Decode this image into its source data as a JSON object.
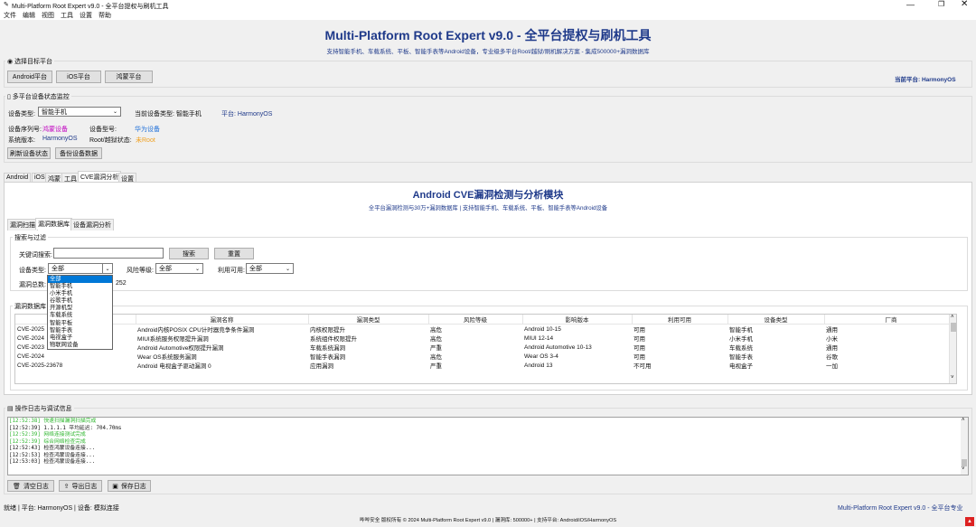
{
  "window": {
    "title": "Multi-Platform Root Expert v9.0 - 全平台提权与刷机工具",
    "menu": [
      "文件",
      "编辑",
      "视图",
      "工具",
      "设置",
      "帮助"
    ]
  },
  "header": {
    "title": "Multi-Platform Root Expert v9.0 - 全平台提权与刷机工具",
    "subtitle": "支持智能手机、车载系统、平板、智能手表等Android设备，专业级多平台Root/越狱/刷机解决方案 - 集成500000+漏洞数据库"
  },
  "platform_select": {
    "label": "选择目标平台",
    "buttons": [
      "Android平台",
      "iOS平台",
      "鸿蒙平台"
    ],
    "current": "当前平台: HarmonyOS"
  },
  "monitor": {
    "label": "多平台设备状态监控",
    "device_type_label": "设备类型:",
    "device_type_value": "智能手机",
    "current_type": "当前设备类型: 智能手机",
    "platform": "平台:  HarmonyOS",
    "serial_label": "设备序列号:",
    "serial_value": "鸿蒙设备",
    "model_label": "设备型号:",
    "model_value": "华为设备",
    "sysver_label": "系统版本:",
    "sysver_value": "HarmonyOS",
    "root_label": "Root/越狱状态:",
    "root_value": "未Root",
    "refresh_btn": "刷新设备状态",
    "backup_btn": "备份设备数据"
  },
  "main_tabs": [
    "Android",
    "iOS",
    "鸿蒙",
    "工具",
    "CVE漏洞分析",
    "设置"
  ],
  "cve": {
    "title": "Android CVE漏洞检测与分析模块",
    "subtitle": "全平台漏洞检测与30万+漏洞数据库 | 支持智能手机、车载系统、平板、智能手表等Android设备",
    "sub_tabs": [
      "漏洞扫描",
      "漏洞数据库",
      "设备漏洞分析"
    ],
    "search": {
      "group_label": "搜索与过滤",
      "keyword_label": "关键词搜索:",
      "keyword_value": "",
      "search_btn": "搜索",
      "reset_btn": "重置",
      "device_type_label": "设备类型:",
      "device_type_value": "全部",
      "risk_label": "风险等级:",
      "risk_value": "全部",
      "exploit_label": "利用可用:",
      "exploit_value": "全部",
      "total_label": "漏洞总数:",
      "total_value": "252"
    },
    "dropdown_options": [
      "全部",
      "智能手机",
      "小米手机",
      "谷歌手机",
      "开源机型",
      "车载系统",
      "智能平板",
      "智能手表",
      "电视盒子",
      "物联网设备"
    ],
    "db_label": "漏洞数据库",
    "columns": [
      "漏洞名称",
      "漏洞类型",
      "风险等级",
      "影响版本",
      "利用可用",
      "设备类型",
      "厂商"
    ],
    "rows": [
      {
        "id": "CVE-2025",
        "name": "Android内核POSIX CPU计时器竞争条件漏洞",
        "type": "内核权限提升",
        "risk": "高危",
        "version": "Android 10-15",
        "exploit": "可用",
        "device": "智能手机",
        "vendor": "通用"
      },
      {
        "id": "CVE-2024",
        "name": "MIUI系统服务权限提升漏洞",
        "type": "系统组件权限提升",
        "risk": "高危",
        "version": "MIUI 12-14",
        "exploit": "可用",
        "device": "小米手机",
        "vendor": "小米"
      },
      {
        "id": "CVE-2023",
        "name": "Android Automotive权限提升漏洞",
        "type": "车载系统漏洞",
        "risk": "严重",
        "version": "Android Automotive 10-13",
        "exploit": "可用",
        "device": "车载系统",
        "vendor": "通用"
      },
      {
        "id": "CVE-2024",
        "name": "Wear OS系统服务漏洞",
        "type": "智能手表漏洞",
        "risk": "高危",
        "version": "Wear OS 3-4",
        "exploit": "可用",
        "device": "智能手表",
        "vendor": "谷歌"
      },
      {
        "id": "CVE-2025-23678",
        "name": "Android 电视盒子驱动漏洞 0",
        "type": "应用漏洞",
        "risk": "严重",
        "version": "Android 13",
        "exploit": "不可用",
        "device": "电视盒子",
        "vendor": "一加"
      }
    ]
  },
  "log": {
    "label": "操作日志与调试信息",
    "lines": [
      {
        "text": "[12:52:38] 快速扫描漏洞扫描完成",
        "color": "#2db52d"
      },
      {
        "text": "[12:52:39] 1.1.1.1 平均延迟: 704.70ms",
        "color": "#111111"
      },
      {
        "text": "[12:52:39] 网络连接测试完成",
        "color": "#2db52d"
      },
      {
        "text": "[12:52:39] 综合网络检查完成",
        "color": "#2db52d"
      },
      {
        "text": "[12:52:43] 检查鸿蒙设备连接...",
        "color": "#111111"
      },
      {
        "text": "[12:52:53] 检查鸿蒙设备连接...",
        "color": "#111111"
      },
      {
        "text": "[12:53:03] 检查鸿蒙设备连接...",
        "color": "#111111"
      }
    ],
    "clear_btn": "清空日志",
    "export_btn": "导出日志",
    "save_btn": "保存日志"
  },
  "status": {
    "left": "就绪 | 平台: HarmonyOS | 设备: 模拟连接",
    "right": "Multi-Platform Root Expert v9.0 - 全平台专业",
    "footer": "哔哔安全 版权所有 © 2024 Multi-Platform Root Expert v9.0 | 漏洞库: 500000+ | 支持平台: Android/iOS/HarmonyOS"
  },
  "colors": {
    "accent": "#0078d7",
    "title_blue": "#1f3a8a",
    "serial": "#c000c0",
    "model": "#1e6fd9",
    "root_warn": "#f0a020",
    "log_green": "#2db52d"
  }
}
